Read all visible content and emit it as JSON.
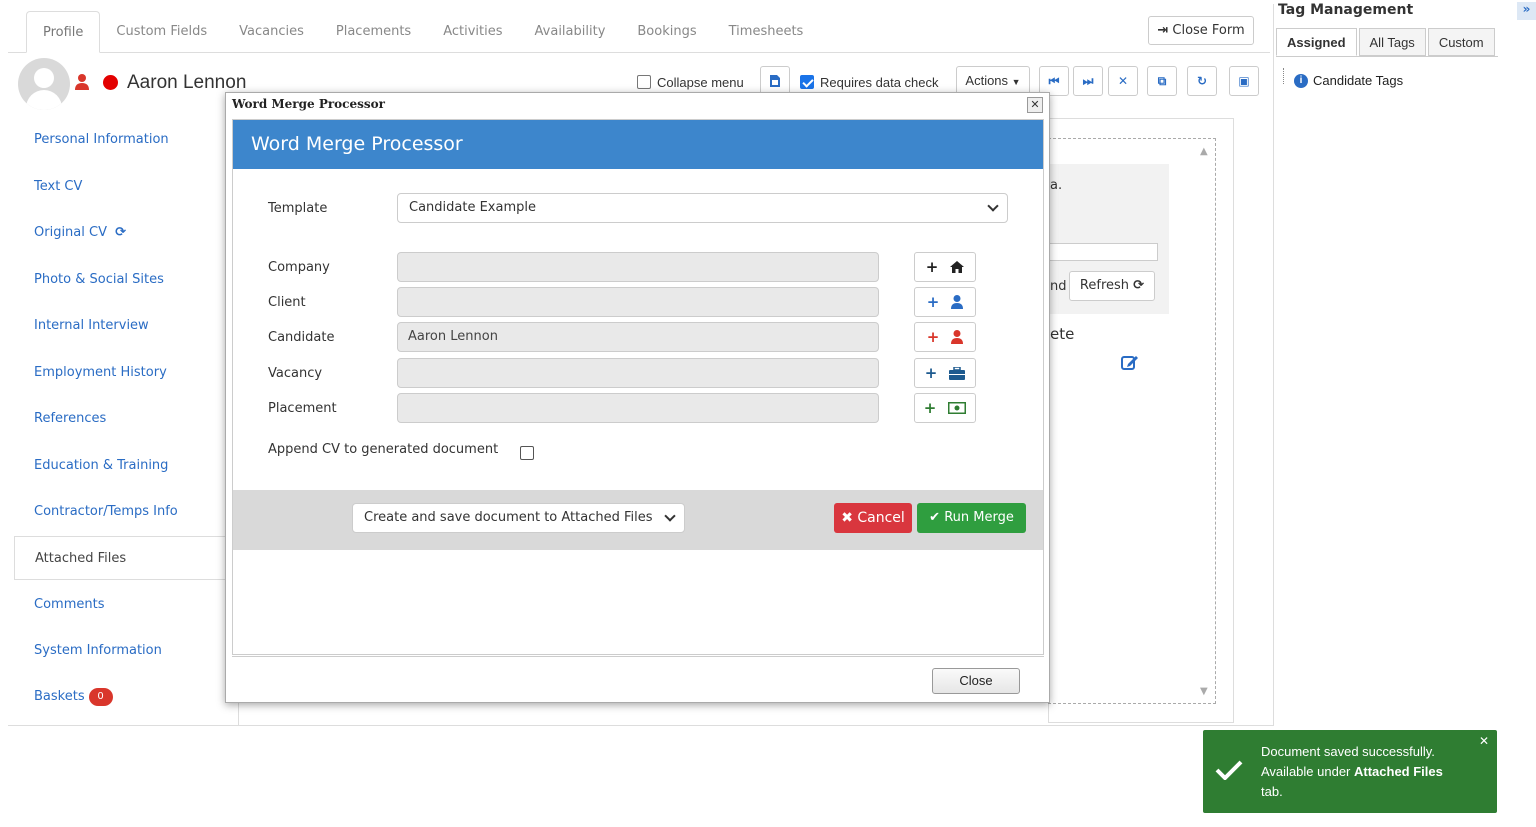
{
  "tabs": [
    "Profile",
    "Custom Fields",
    "Vacancies",
    "Placements",
    "Activities",
    "Availability",
    "Bookings",
    "Timesheets"
  ],
  "close_form_label": "Close Form",
  "candidate": {
    "name": "Aaron Lennon"
  },
  "toolbar": {
    "collapse_menu_label": "Collapse menu",
    "requires_data_check_label": "Requires data check",
    "actions_label": "Actions"
  },
  "sidebar": {
    "items": [
      {
        "label": "Personal Information"
      },
      {
        "label": "Text CV"
      },
      {
        "label": "Original CV"
      },
      {
        "label": "Photo & Social Sites"
      },
      {
        "label": "Internal Interview"
      },
      {
        "label": "Employment History"
      },
      {
        "label": "References"
      },
      {
        "label": "Education & Training"
      },
      {
        "label": "Contractor/Temps Info"
      },
      {
        "label": "Attached Files"
      },
      {
        "label": "Comments"
      },
      {
        "label": "System Information"
      },
      {
        "label": "Baskets"
      }
    ],
    "baskets_count": "0"
  },
  "background": {
    "snippet_a": "a.",
    "snippet_nd": "nd",
    "refresh_label": "Refresh",
    "snippet_ete": "ete"
  },
  "tag_management": {
    "title": "Tag Management",
    "expand": "»",
    "tabs": [
      "Assigned",
      "All Tags",
      "Custom"
    ],
    "tree_item": "Candidate Tags"
  },
  "dialog": {
    "window_title": "Word Merge Processor",
    "header": "Word Merge Processor",
    "template_label": "Template",
    "template_value": "Candidate Example",
    "fields": [
      {
        "label": "Company",
        "value": ""
      },
      {
        "label": "Client",
        "value": ""
      },
      {
        "label": "Candidate",
        "value": "Aaron Lennon"
      },
      {
        "label": "Vacancy",
        "value": ""
      },
      {
        "label": "Placement",
        "value": ""
      }
    ],
    "append_cv_label": "Append CV to generated document",
    "output_option": "Create and save document to Attached Files",
    "cancel_label": "Cancel",
    "run_merge_label": "Run Merge",
    "close_label": "Close"
  },
  "toast": {
    "line1": "Document saved successfully.",
    "line2_prefix": "Available under ",
    "line2_bold": "Attached Files",
    "line3": "tab."
  },
  "colors": {
    "accent": "#3d86cc",
    "link": "#2a6cc4",
    "danger": "#d9363e",
    "success": "#2f9e3f",
    "toast": "#2f7d32"
  }
}
